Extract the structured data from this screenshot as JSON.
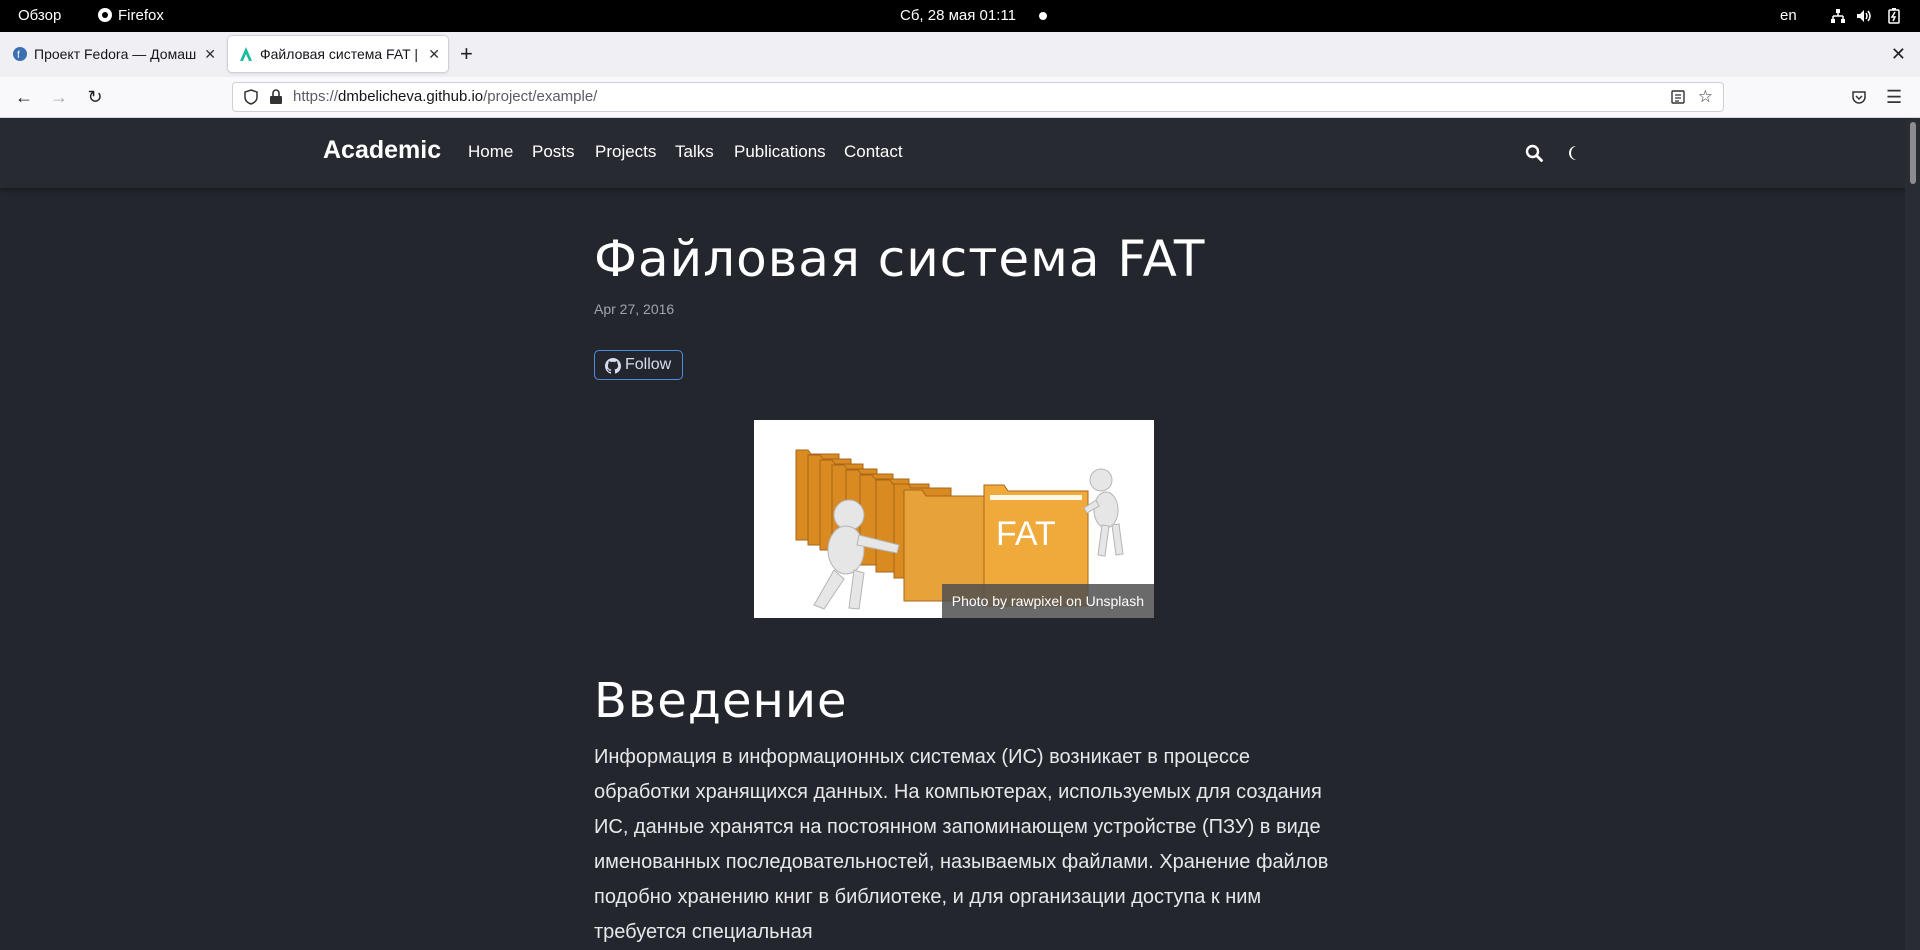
{
  "system_bar": {
    "activities": "Обзор",
    "app_name": "Firefox",
    "clock": "Сб, 28 мая  01:11",
    "language": "en"
  },
  "tabs": [
    {
      "title": "Проект Fedora — Домашняя страница",
      "active": false,
      "icon": "fedora-icon"
    },
    {
      "title": "Файловая система FAT | Academic",
      "active": true,
      "icon": "academic-icon"
    }
  ],
  "url": {
    "scheme": "https://",
    "host": "dmbelicheva.github.io",
    "path": "/project/example/"
  },
  "site": {
    "brand": "Academic",
    "nav": [
      "Home",
      "Posts",
      "Projects",
      "Talks",
      "Publications",
      "Contact"
    ]
  },
  "article": {
    "title": "Файловая система FAT",
    "date": "Apr 27, 2016",
    "follow_label": "Follow",
    "image_label": "FAT",
    "image_caption": "Photo by rawpixel on Unsplash",
    "section_heading": "Введение",
    "paragraph": "Информация в информационных системах (ИС) возникает в процессе обработки хранящихся данных. На компьютерах, используемых для создания ИС, данные хранятся на постоянном запоминающем устройстве (ПЗУ) в виде именованных последовательностей, называемых файлами. Хранение файлов подобно хранению книг в библиотеке, и для организации доступа к ним требуется специальная"
  },
  "colors": {
    "page_bg": "#24262e",
    "nav_bg": "#272a31",
    "accent": "#4d8be3",
    "folder": "#e8a23a"
  }
}
